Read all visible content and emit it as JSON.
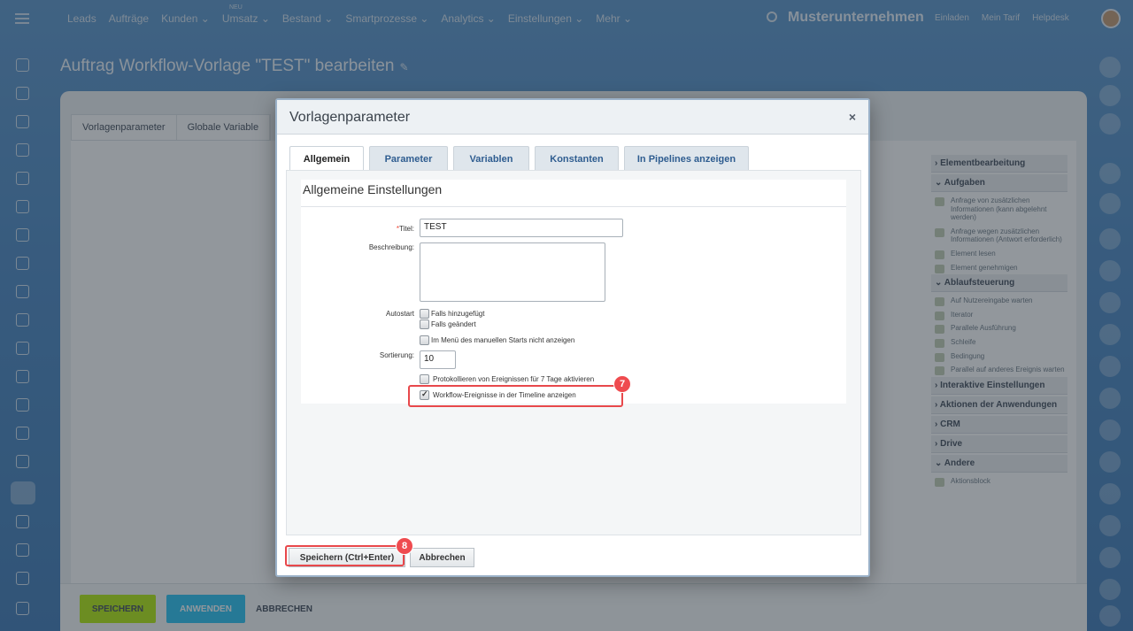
{
  "topbar": {
    "nav": [
      "Leads",
      "Aufträge",
      "Kunden ⌄",
      "Umsatz ⌄",
      "Bestand ⌄",
      "Smartprozesse ⌄",
      "Analytics ⌄",
      "Einstellungen ⌄",
      "Mehr ⌄"
    ],
    "nav_small": "NEU",
    "company": "Musterunternehmen",
    "links": [
      "Einladen",
      "Mein Tarif",
      "Helpdesk"
    ]
  },
  "page": {
    "title": "Auftrag Workflow-Vorlage \"TEST\" bearbeiten",
    "tabs": [
      "Vorlagenparameter",
      "Globale Variable"
    ]
  },
  "toolbox": {
    "sections": [
      {
        "title": "› Elementbearbeitung",
        "items": []
      },
      {
        "title": "⌄ Aufgaben",
        "items": [
          "Anfrage von zusätzlichen Informationen (kann abgelehnt werden)",
          "Anfrage wegen zusätzlichen Informationen (Antwort erforderlich)",
          "Element lesen",
          "Element genehmigen"
        ]
      },
      {
        "title": "⌄ Ablaufsteuerung",
        "items": [
          "Auf Nutzereingabe warten",
          "Iterator",
          "Parallele Ausführung",
          "Schleife",
          "Bedingung",
          "Parallel auf anderes Ereignis warten"
        ]
      },
      {
        "title": "› Interaktive Einstellungen",
        "items": []
      },
      {
        "title": "› Aktionen der Anwendungen",
        "items": []
      },
      {
        "title": "› CRM",
        "items": []
      },
      {
        "title": "› Drive",
        "items": []
      },
      {
        "title": "⌄ Andere",
        "items": [
          "Aktionsblock"
        ]
      }
    ]
  },
  "footer": {
    "save": "SPEICHERN",
    "apply": "ANWENDEN",
    "cancel": "ABBRECHEN"
  },
  "dialog": {
    "title": "Vorlagenparameter",
    "close": "×",
    "tabs": [
      "Allgemein",
      "Parameter",
      "Variablen",
      "Konstanten",
      "In Pipelines anzeigen"
    ],
    "section_title": "Allgemeine Einstellungen",
    "fields": {
      "title_label": "Titel:",
      "title_required": "*",
      "title_value": "TEST",
      "description_label": "Beschreibung:",
      "description_value": "",
      "autostart_label": "Autostart",
      "autostart_added": "Falls hinzugefügt",
      "autostart_changed": "Falls geändert",
      "hide_manual": "Im Menü des manuellen Starts nicht anzeigen",
      "sort_label": "Sortierung:",
      "sort_value": "10",
      "log_events": "Protokollieren von Ereignissen für 7 Tage aktivieren",
      "timeline_events": "Workflow-Ereignisse in der Timeline anzeigen"
    },
    "checkboxes": {
      "autostart_added": false,
      "autostart_changed": false,
      "hide_manual": false,
      "log_events": false,
      "timeline_events": true
    },
    "buttons": {
      "save": "Speichern (Ctrl+Enter)",
      "cancel": "Abbrechen"
    }
  },
  "annotations": {
    "step7": "7",
    "step8": "8",
    "color": "#e8484b"
  }
}
